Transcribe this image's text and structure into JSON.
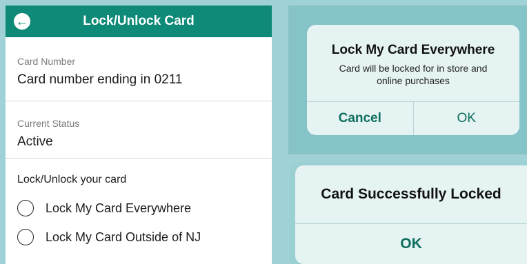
{
  "lock_screen": {
    "title": "Lock/Unlock Card",
    "card_number_label": "Card Number",
    "card_number_value": "Card number ending in 0211",
    "status_label": "Current Status",
    "status_value": "Active",
    "lock_section_title": "Lock/Unlock your card",
    "options": [
      "Lock My Card Everywhere",
      "Lock My Card Outside of NJ"
    ],
    "back_icon": "arrow-left-icon"
  },
  "confirm_dialog": {
    "title": "Lock My Card Everywhere",
    "message": "Card will be locked for in store and online purchases",
    "cancel_label": "Cancel",
    "ok_label": "OK"
  },
  "success_dialog": {
    "title": "Card Successfully Locked",
    "ok_label": "OK"
  },
  "colors": {
    "header": "#0f8a78",
    "background": "#9fd1d6",
    "dialog": "#e5f3f3",
    "action_text": "#0f6f5f"
  }
}
